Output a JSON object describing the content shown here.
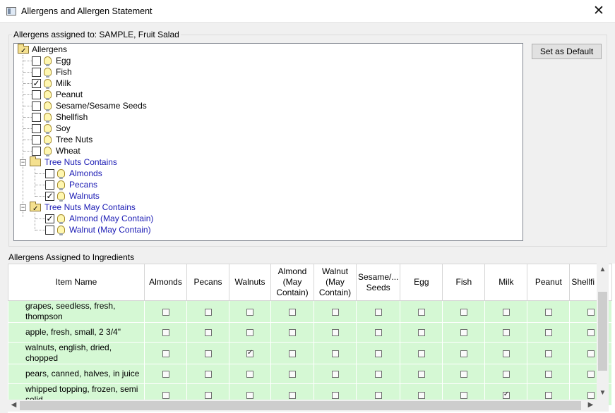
{
  "window": {
    "title": "Allergens and Allergen Statement",
    "close_glyph": "✕",
    "icon": "window-app-icon"
  },
  "assigned_group": {
    "legend": "Allergens assigned to: SAMPLE, Fruit Salad"
  },
  "buttons": {
    "set_default": "Set as Default"
  },
  "tree": {
    "root_label": "Allergens",
    "allergens": [
      {
        "label": "Egg",
        "checked": false
      },
      {
        "label": "Fish",
        "checked": false
      },
      {
        "label": "Milk",
        "checked": true
      },
      {
        "label": "Peanut",
        "checked": false
      },
      {
        "label": "Sesame/Sesame Seeds",
        "checked": false
      },
      {
        "label": "Shellfish",
        "checked": false
      },
      {
        "label": "Soy",
        "checked": false
      },
      {
        "label": "Tree Nuts",
        "checked": false
      },
      {
        "label": "Wheat",
        "checked": false
      }
    ],
    "tree_nuts_contains": {
      "label": "Tree Nuts Contains",
      "items": [
        {
          "label": "Almonds",
          "checked": false
        },
        {
          "label": "Pecans",
          "checked": false
        },
        {
          "label": "Walnuts",
          "checked": true
        }
      ]
    },
    "tree_nuts_may_contain": {
      "label": "Tree Nuts May Contains",
      "items": [
        {
          "label": "Almond (May Contain)",
          "checked": true
        },
        {
          "label": "Walnut (May Contain)",
          "checked": false
        }
      ]
    }
  },
  "ingredients": {
    "section_label": "Allergens Assigned to Ingredients",
    "columns": {
      "item_name": "Item Name",
      "almonds": "Almonds",
      "pecans": "Pecans",
      "walnuts": "Walnuts",
      "almond_may_1": "Almond",
      "almond_may_2": "(May",
      "almond_may_3": "Contain)",
      "walnut_may_1": "Walnut",
      "walnut_may_2": "(May",
      "walnut_may_3": "Contain)",
      "sesame_1": "Sesame/...",
      "sesame_2": "Seeds",
      "egg": "Egg",
      "fish": "Fish",
      "milk": "Milk",
      "peanut": "Peanut",
      "shellfish": "Shellfi"
    },
    "rows": [
      {
        "name_1": "grapes, seedless, fresh,",
        "name_2": "thompson",
        "checks": [
          false,
          false,
          false,
          false,
          false,
          false,
          false,
          false,
          false,
          false,
          false
        ]
      },
      {
        "name_1": "apple, fresh, small, 2 3/4\"",
        "name_2": "",
        "checks": [
          false,
          false,
          false,
          false,
          false,
          false,
          false,
          false,
          false,
          false,
          false
        ]
      },
      {
        "name_1": "walnuts, english, dried,",
        "name_2": "chopped",
        "checks": [
          false,
          false,
          true,
          false,
          false,
          false,
          false,
          false,
          false,
          false,
          false
        ]
      },
      {
        "name_1": "pears, canned, halves, in juice",
        "name_2": "",
        "checks": [
          false,
          false,
          false,
          false,
          false,
          false,
          false,
          false,
          false,
          false,
          false
        ]
      },
      {
        "name_1": "whipped topping, frozen, semi",
        "name_2": "solid",
        "checks": [
          false,
          false,
          false,
          false,
          false,
          false,
          false,
          false,
          true,
          false,
          false
        ]
      }
    ]
  },
  "scroll": {
    "up": "▲",
    "down": "▼",
    "left": "◀",
    "right": "▶"
  },
  "colors": {
    "row_bg": "#d5f8d4",
    "tree_child_text": "#1a1ab4"
  }
}
